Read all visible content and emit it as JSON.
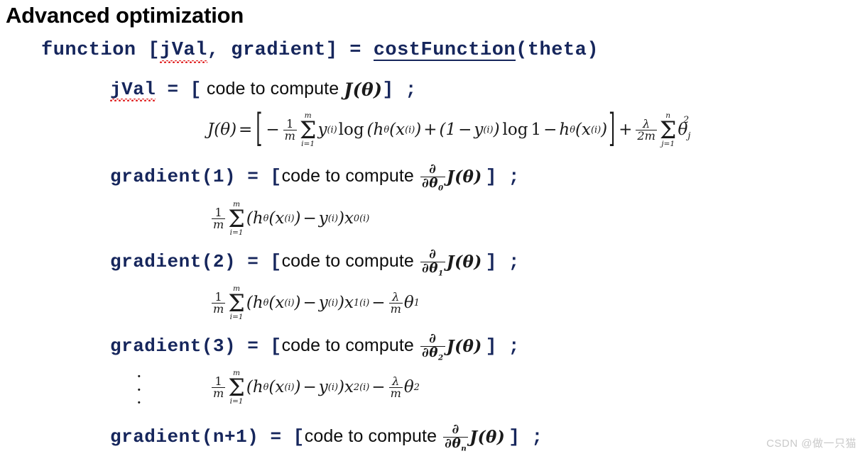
{
  "slide": {
    "title": "Advanced optimization",
    "background_color": "#ffffff",
    "code_color": "#16265c",
    "prose_color": "#0d0d0d",
    "spellcheck_underline_color": "#e02020"
  },
  "signature_line": {
    "keyword": "function",
    "open_bracket": " [",
    "out1": "jVal",
    "comma": ", ",
    "out2": "gradient",
    "close_bracket": "] ",
    "equals": "= ",
    "fn_name": "costFunction",
    "args": "(theta)"
  },
  "jval_line": {
    "name": "jVal",
    "equals": " = ",
    "open": "[",
    "prose": " code to compute ",
    "math": "J(θ)",
    "close": "] ;"
  },
  "cost_formula": {
    "latex": "J(\\theta) = \\left[-\\frac{1}{m}\\sum_{i=1}^{m} y^{(i)}\\log\\left(h_\\theta(x^{(i)}) + (1-y^{(i)})\\log 1 - h_\\theta(x^{(i)})\\right] + \\frac{\\lambda}{2m}\\sum_{j=1}^{n}\\theta_j^2",
    "plain": "J(θ) = [ -1/m Σ(i=1..m) y^(i) log (hθ(x^(i)) + (1 - y^(i)) log 1 - hθ(x^(i))] + λ/2m Σ(j=1..n) θj²"
  },
  "gradients": [
    {
      "name": "gradient(1)",
      "equals": " = ",
      "open": "[",
      "prose": "code to compute ",
      "derivative_sub": "0",
      "close": "] ;",
      "formula_plain": "1/m Σ(i=1..m) (hθ(x^(i)) - y^(i))x₀^(i)",
      "formula_has_reg": false,
      "reg_sub": ""
    },
    {
      "name": "gradient(2)",
      "equals": " = ",
      "open": "[",
      "prose": "code to compute ",
      "derivative_sub": "1",
      "close": "] ;",
      "formula_plain": "1/m Σ(i=1..m) (hθ(x^(i)) - y^(i))x₁^(i) - λ/m θ₁",
      "formula_has_reg": true,
      "reg_sub": "1"
    },
    {
      "name": "gradient(3)",
      "equals": " = ",
      "open": "[",
      "prose": "code to compute ",
      "derivative_sub": "2",
      "close": "] ;",
      "formula_plain": "1/m Σ(i=1..m) (hθ(x^(i)) - y^(i))x₂^(i) - λ/m θ₂",
      "formula_has_reg": true,
      "reg_sub": "2"
    },
    {
      "name": "gradient(n+1)",
      "equals": " = ",
      "open": "[",
      "prose": "code to compute ",
      "derivative_sub": "n",
      "close": "] ;",
      "formula_plain": "",
      "formula_has_reg": false,
      "reg_sub": ""
    }
  ],
  "ellipsis": "⋮",
  "watermark": "CSDN @做一只猫"
}
